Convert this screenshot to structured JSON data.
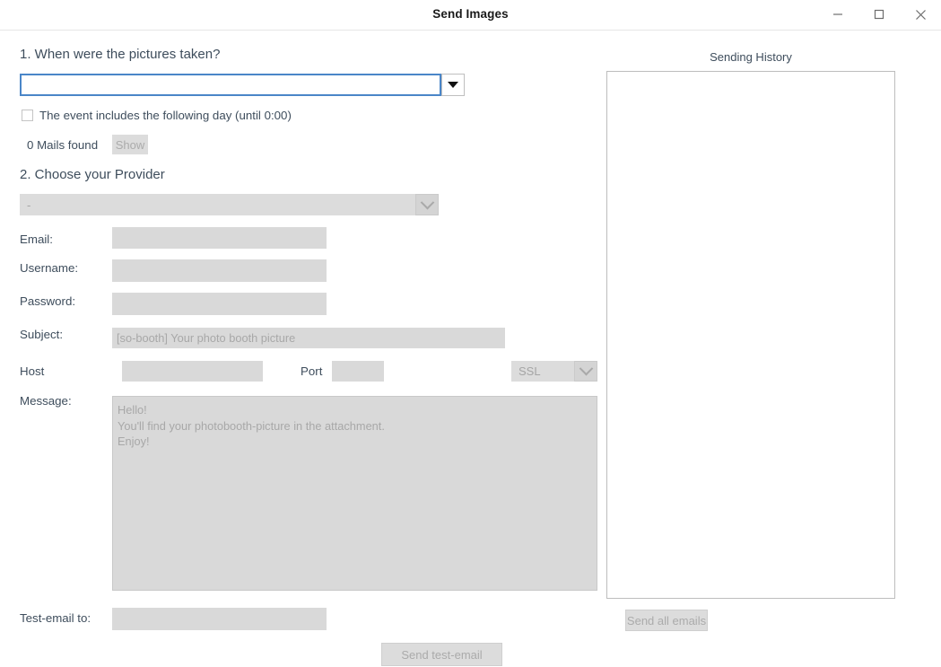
{
  "window": {
    "title": "Send Images",
    "minimize_label": "—",
    "maximize_label": "□",
    "close_label": "✕"
  },
  "step1": {
    "heading": "1. When were the pictures taken?",
    "date_value": "",
    "date_placeholder": "",
    "dropdown_icon": "triangle-down-icon",
    "checkbox_label": "The event includes the following day (until 0:00)",
    "checkbox_checked": false,
    "mails_found": "0 Mails found",
    "show_button": "Show"
  },
  "step2": {
    "heading": "2. Choose your Provider",
    "provider_value": "-",
    "provider_icon": "chevron-down-icon",
    "fields": {
      "email_label": "Email:",
      "email_value": "",
      "username_label": "Username:",
      "username_value": "",
      "password_label": "Password:",
      "password_value": "",
      "subject_label": "Subject:",
      "subject_placeholder": "[so-booth] Your photo booth picture",
      "host_label": "Host",
      "host_value": "",
      "port_label": "Port",
      "port_value": "",
      "ssl_value": "SSL",
      "ssl_icon": "chevron-down-icon",
      "message_label": "Message:",
      "message_placeholder": "Hello!\nYou'll find your photobooth-picture in the attachment.\nEnjoy!"
    }
  },
  "footer": {
    "test_email_label": "Test-email to:",
    "test_email_value": "",
    "send_test_button": "Send test-email"
  },
  "history": {
    "title": "Sending History",
    "entries": [],
    "send_all_button": "Send all emails"
  },
  "colors": {
    "focus_border": "#4a86c8",
    "disabled_fill": "#d9d9d9",
    "disabled_text": "#a8a8a8",
    "label_text": "#3e4d5c"
  }
}
